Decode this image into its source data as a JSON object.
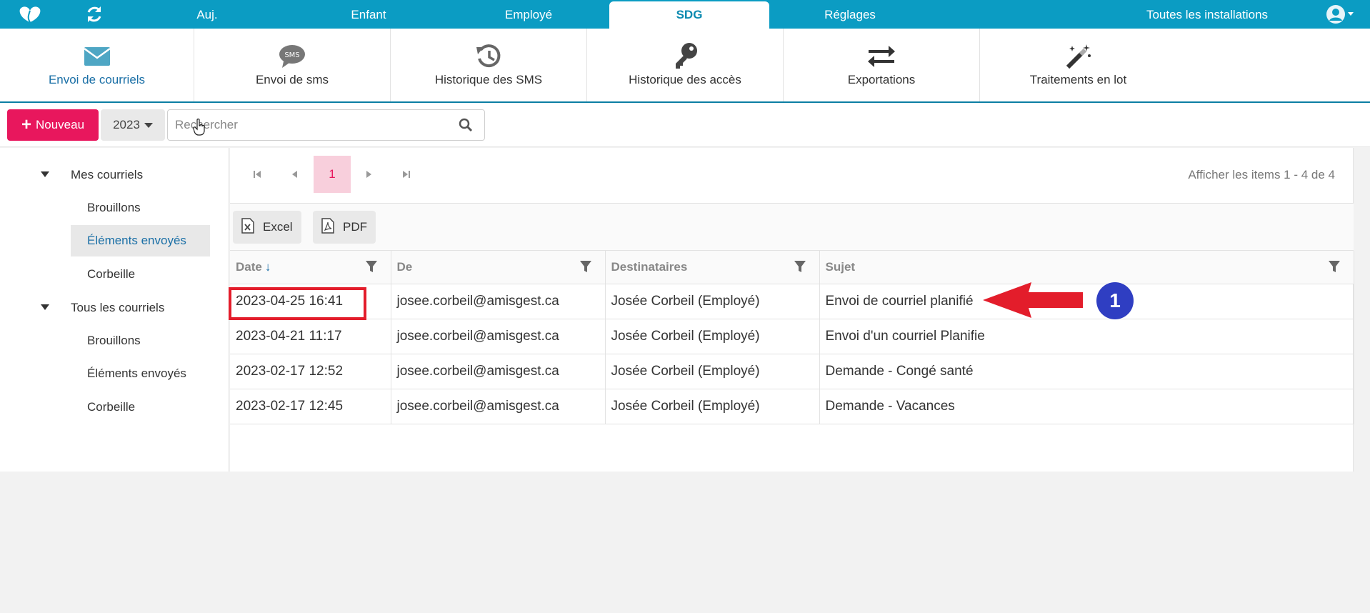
{
  "topnav": {
    "tabs": [
      {
        "label": "Auj."
      },
      {
        "label": "Enfant"
      },
      {
        "label": "Employé"
      },
      {
        "label": "SDG"
      },
      {
        "label": "Réglages"
      },
      {
        "label": "Toutes les installations"
      }
    ],
    "active_tab": "SDG",
    "icons": [
      "logo-icon",
      "refresh-icon",
      "user-avatar-icon"
    ],
    "colors": {
      "bar": "#0b9cc3",
      "active_text": "#0b8ab0"
    }
  },
  "subbar": {
    "items": [
      {
        "label": "Envoi de courriels",
        "icon": "envelope-icon"
      },
      {
        "label": "Envoi de sms",
        "icon": "sms-icon"
      },
      {
        "label": "Historique des SMS",
        "icon": "history-icon"
      },
      {
        "label": "Historique des accès",
        "icon": "key-icon"
      },
      {
        "label": "Exportations",
        "icon": "exchange-icon"
      },
      {
        "label": "Traitements en lot",
        "icon": "magic-wand-icon"
      }
    ],
    "active": "Envoi de courriels"
  },
  "actions": {
    "new_label": "Nouveau",
    "year": "2023",
    "search_placeholder": "Rechercher",
    "colors": {
      "new_button": "#e8175d"
    }
  },
  "tree": {
    "groups": [
      {
        "label": "Mes courriels",
        "children": [
          "Brouillons",
          "Éléments envoyés",
          "Corbeille"
        ]
      },
      {
        "label": "Tous les courriels",
        "children": [
          "Brouillons",
          "Éléments envoyés",
          "Corbeille"
        ]
      }
    ],
    "selected": "Mes courriels / Éléments envoyés"
  },
  "pager": {
    "current_page": "1",
    "info": "Afficher les items 1 - 4 de 4"
  },
  "export": {
    "excel_label": "Excel",
    "pdf_label": "PDF"
  },
  "grid": {
    "columns": [
      "Date",
      "De",
      "Destinataires",
      "Sujet"
    ],
    "sort": {
      "column": "Date",
      "direction": "descending"
    },
    "rows": [
      {
        "date": "2023-04-25 16:41",
        "from": "josee.corbeil@amisgest.ca",
        "to": "Josée Corbeil (Employé)",
        "subject": "Envoi de courriel planifié"
      },
      {
        "date": "2023-04-21 11:17",
        "from": "josee.corbeil@amisgest.ca",
        "to": "Josée Corbeil (Employé)",
        "subject": "Envoi d'un courriel Planifie"
      },
      {
        "date": "2023-02-17 12:52",
        "from": "josee.corbeil@amisgest.ca",
        "to": "Josée Corbeil (Employé)",
        "subject": "Demande - Congé santé"
      },
      {
        "date": "2023-02-17 12:45",
        "from": "josee.corbeil@amisgest.ca",
        "to": "Josée Corbeil (Employé)",
        "subject": "Demande - Vacances"
      }
    ]
  },
  "annotation": {
    "badge": "1",
    "colors": {
      "highlight": "#e31d2b",
      "badge": "#2f3ec2"
    }
  }
}
